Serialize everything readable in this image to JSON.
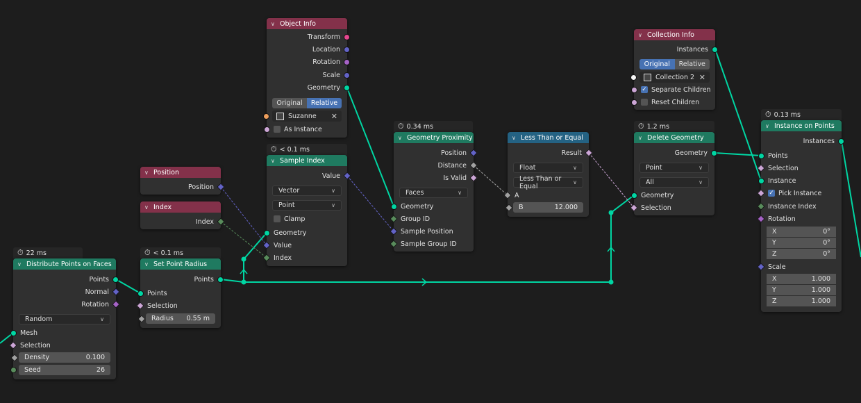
{
  "colors": {
    "geometry_socket": "#00d6a3",
    "vector_socket": "#6363c7",
    "float_socket": "#a1a1a1",
    "int_socket": "#598c5c",
    "bool_socket": "#cca6d6",
    "instance_socket": "#00d6a3",
    "object_socket": "#ed9e5c",
    "collection_socket": "#f5f5f5",
    "rotation_socket": "#a663c7",
    "transform_socket": "#e5478f",
    "header_input": "#83314a",
    "header_geometry": "#1f7a60",
    "header_converter": "#246283",
    "toggle_active": "#4772b3"
  },
  "icons": {
    "timing": "stopwatch-icon",
    "collapse": "chevron-down-icon",
    "dropdown": "dropdown-arrow-icon",
    "clear": "close-icon"
  },
  "object_info": {
    "title": "Object Info",
    "outputs": [
      "Transform",
      "Location",
      "Rotation",
      "Scale",
      "Geometry"
    ],
    "mode_original": "Original",
    "mode_relative": "Relative",
    "object": "Suzanne",
    "clear_glyph": "✕",
    "as_instance": "As Instance"
  },
  "position": {
    "title": "Position",
    "output": "Position"
  },
  "index": {
    "title": "Index",
    "output": "Index"
  },
  "sample_index": {
    "timing": "< 0.1 ms",
    "title": "Sample Index",
    "output": "Value",
    "data_type": "Vector",
    "domain": "Point",
    "clamp": "Clamp",
    "inputs": [
      "Geometry",
      "Value",
      "Index"
    ]
  },
  "distribute": {
    "timing": "22 ms",
    "title": "Distribute Points on Faces",
    "outputs": [
      "Points",
      "Normal",
      "Rotation"
    ],
    "mode": "Random",
    "inputs": [
      "Mesh",
      "Selection"
    ],
    "density_label": "Density",
    "density_value": "0.100",
    "seed_label": "Seed",
    "seed_value": "26"
  },
  "set_point_radius": {
    "timing": "< 0.1 ms",
    "title": "Set Point Radius",
    "output": "Points",
    "inputs": [
      "Points",
      "Selection"
    ],
    "radius_label": "Radius",
    "radius_value": "0.55 m"
  },
  "geometry_proximity": {
    "timing": "0.34 ms",
    "title": "Geometry Proximity",
    "outputs": [
      "Position",
      "Distance",
      "Is Valid"
    ],
    "target": "Faces",
    "inputs": [
      "Geometry",
      "Group ID",
      "Sample Position",
      "Sample Group ID"
    ]
  },
  "less_than": {
    "title": "Less Than or Equal",
    "output": "Result",
    "data_type": "Float",
    "operation": "Less Than or Equal",
    "input_a": "A",
    "b_label": "B",
    "b_value": "12.000"
  },
  "collection_info": {
    "title": "Collection Info",
    "output": "Instances",
    "mode_original": "Original",
    "mode_relative": "Relative",
    "collection": "Collection 2",
    "clear_glyph": "✕",
    "separate_children": "Separate Children",
    "reset_children": "Reset Children",
    "check_glyph": "✓"
  },
  "delete_geometry": {
    "timing": "1.2 ms",
    "title": "Delete Geometry",
    "output": "Geometry",
    "domain": "Point",
    "mode": "All",
    "inputs": [
      "Geometry",
      "Selection"
    ]
  },
  "instance_on_points": {
    "timing": "0.13 ms",
    "title": "Instance on Points",
    "output": "Instances",
    "inputs": [
      "Points",
      "Selection",
      "Instance"
    ],
    "pick_instance": "Pick Instance",
    "instance_index": "Instance Index",
    "rotation": "Rotation",
    "rotation_x": "0°",
    "rotation_y": "0°",
    "rotation_z": "0°",
    "scale": "Scale",
    "scale_x": "1.000",
    "scale_y": "1.000",
    "scale_z": "1.000",
    "axis_x": "X",
    "axis_y": "Y",
    "axis_z": "Z",
    "check_glyph": "✓"
  }
}
